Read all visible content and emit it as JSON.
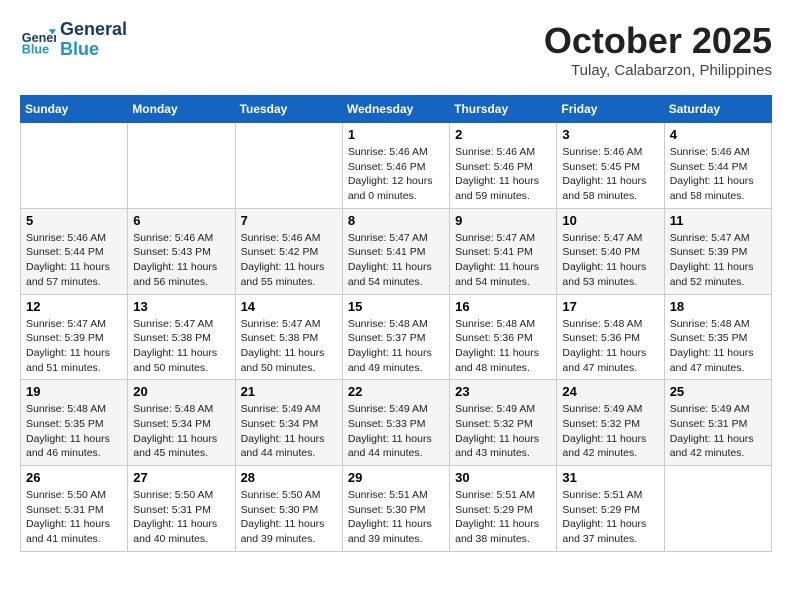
{
  "header": {
    "logo_line1": "General",
    "logo_line2": "Blue",
    "month": "October 2025",
    "location": "Tulay, Calabarzon, Philippines"
  },
  "days_of_week": [
    "Sunday",
    "Monday",
    "Tuesday",
    "Wednesday",
    "Thursday",
    "Friday",
    "Saturday"
  ],
  "weeks": [
    [
      {
        "day": "",
        "info": ""
      },
      {
        "day": "",
        "info": ""
      },
      {
        "day": "",
        "info": ""
      },
      {
        "day": "1",
        "info": "Sunrise: 5:46 AM\nSunset: 5:46 PM\nDaylight: 12 hours\nand 0 minutes."
      },
      {
        "day": "2",
        "info": "Sunrise: 5:46 AM\nSunset: 5:46 PM\nDaylight: 11 hours\nand 59 minutes."
      },
      {
        "day": "3",
        "info": "Sunrise: 5:46 AM\nSunset: 5:45 PM\nDaylight: 11 hours\nand 58 minutes."
      },
      {
        "day": "4",
        "info": "Sunrise: 5:46 AM\nSunset: 5:44 PM\nDaylight: 11 hours\nand 58 minutes."
      }
    ],
    [
      {
        "day": "5",
        "info": "Sunrise: 5:46 AM\nSunset: 5:44 PM\nDaylight: 11 hours\nand 57 minutes."
      },
      {
        "day": "6",
        "info": "Sunrise: 5:46 AM\nSunset: 5:43 PM\nDaylight: 11 hours\nand 56 minutes."
      },
      {
        "day": "7",
        "info": "Sunrise: 5:46 AM\nSunset: 5:42 PM\nDaylight: 11 hours\nand 55 minutes."
      },
      {
        "day": "8",
        "info": "Sunrise: 5:47 AM\nSunset: 5:41 PM\nDaylight: 11 hours\nand 54 minutes."
      },
      {
        "day": "9",
        "info": "Sunrise: 5:47 AM\nSunset: 5:41 PM\nDaylight: 11 hours\nand 54 minutes."
      },
      {
        "day": "10",
        "info": "Sunrise: 5:47 AM\nSunset: 5:40 PM\nDaylight: 11 hours\nand 53 minutes."
      },
      {
        "day": "11",
        "info": "Sunrise: 5:47 AM\nSunset: 5:39 PM\nDaylight: 11 hours\nand 52 minutes."
      }
    ],
    [
      {
        "day": "12",
        "info": "Sunrise: 5:47 AM\nSunset: 5:39 PM\nDaylight: 11 hours\nand 51 minutes."
      },
      {
        "day": "13",
        "info": "Sunrise: 5:47 AM\nSunset: 5:38 PM\nDaylight: 11 hours\nand 50 minutes."
      },
      {
        "day": "14",
        "info": "Sunrise: 5:47 AM\nSunset: 5:38 PM\nDaylight: 11 hours\nand 50 minutes."
      },
      {
        "day": "15",
        "info": "Sunrise: 5:48 AM\nSunset: 5:37 PM\nDaylight: 11 hours\nand 49 minutes."
      },
      {
        "day": "16",
        "info": "Sunrise: 5:48 AM\nSunset: 5:36 PM\nDaylight: 11 hours\nand 48 minutes."
      },
      {
        "day": "17",
        "info": "Sunrise: 5:48 AM\nSunset: 5:36 PM\nDaylight: 11 hours\nand 47 minutes."
      },
      {
        "day": "18",
        "info": "Sunrise: 5:48 AM\nSunset: 5:35 PM\nDaylight: 11 hours\nand 47 minutes."
      }
    ],
    [
      {
        "day": "19",
        "info": "Sunrise: 5:48 AM\nSunset: 5:35 PM\nDaylight: 11 hours\nand 46 minutes."
      },
      {
        "day": "20",
        "info": "Sunrise: 5:48 AM\nSunset: 5:34 PM\nDaylight: 11 hours\nand 45 minutes."
      },
      {
        "day": "21",
        "info": "Sunrise: 5:49 AM\nSunset: 5:34 PM\nDaylight: 11 hours\nand 44 minutes."
      },
      {
        "day": "22",
        "info": "Sunrise: 5:49 AM\nSunset: 5:33 PM\nDaylight: 11 hours\nand 44 minutes."
      },
      {
        "day": "23",
        "info": "Sunrise: 5:49 AM\nSunset: 5:32 PM\nDaylight: 11 hours\nand 43 minutes."
      },
      {
        "day": "24",
        "info": "Sunrise: 5:49 AM\nSunset: 5:32 PM\nDaylight: 11 hours\nand 42 minutes."
      },
      {
        "day": "25",
        "info": "Sunrise: 5:49 AM\nSunset: 5:31 PM\nDaylight: 11 hours\nand 42 minutes."
      }
    ],
    [
      {
        "day": "26",
        "info": "Sunrise: 5:50 AM\nSunset: 5:31 PM\nDaylight: 11 hours\nand 41 minutes."
      },
      {
        "day": "27",
        "info": "Sunrise: 5:50 AM\nSunset: 5:31 PM\nDaylight: 11 hours\nand 40 minutes."
      },
      {
        "day": "28",
        "info": "Sunrise: 5:50 AM\nSunset: 5:30 PM\nDaylight: 11 hours\nand 39 minutes."
      },
      {
        "day": "29",
        "info": "Sunrise: 5:51 AM\nSunset: 5:30 PM\nDaylight: 11 hours\nand 39 minutes."
      },
      {
        "day": "30",
        "info": "Sunrise: 5:51 AM\nSunset: 5:29 PM\nDaylight: 11 hours\nand 38 minutes."
      },
      {
        "day": "31",
        "info": "Sunrise: 5:51 AM\nSunset: 5:29 PM\nDaylight: 11 hours\nand 37 minutes."
      },
      {
        "day": "",
        "info": ""
      }
    ]
  ]
}
